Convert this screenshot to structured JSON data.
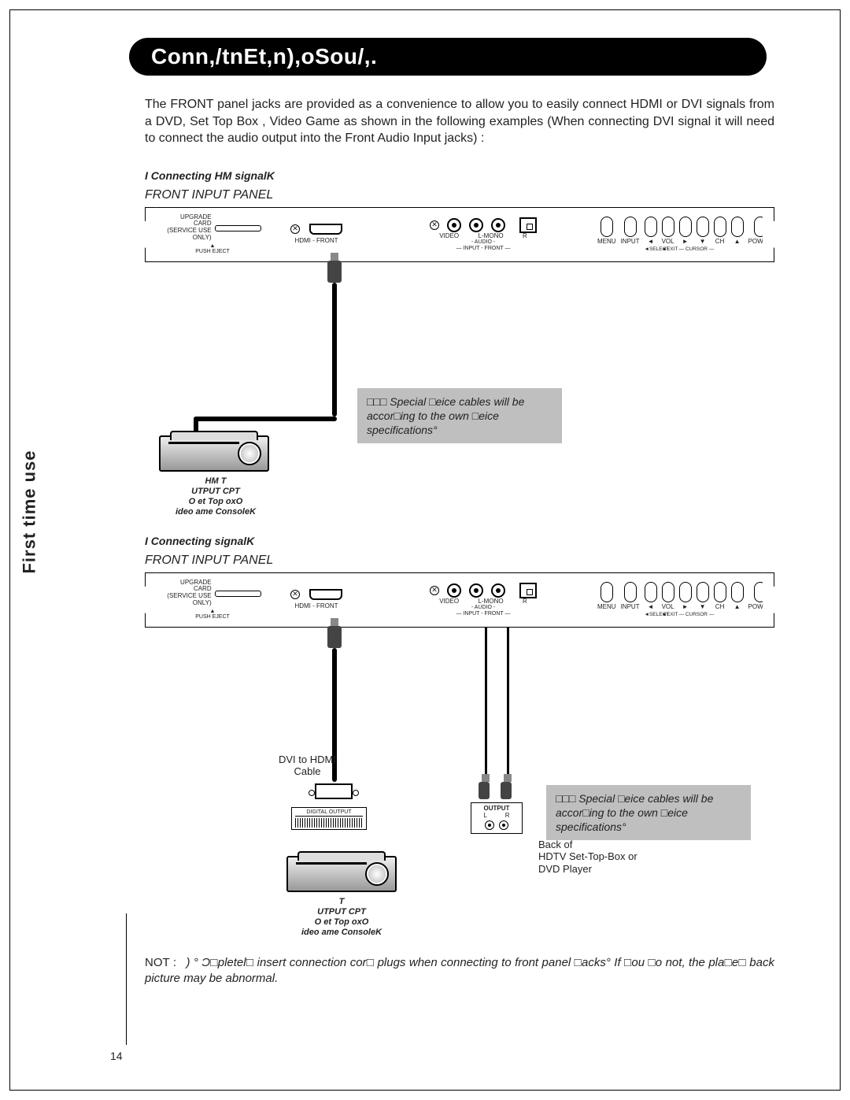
{
  "sidebar_text": "First time use",
  "title": "Conn,/tnEt,n),oSou/,.",
  "intro": "The FRONT panel jacks are provided as a convenience to allow you to easily connect HDMI or DVI signals from a DVD, Set Top Box , Video Game as shown in the following examples (When connecting DVI signal it will need to connect the audio output into the Front Audio Input jacks) :",
  "section1_heading": "I Connecting HM signalK",
  "section2_heading": "I Connecting  signalK",
  "panel_title": "FRONT INPUT PANEL",
  "panel": {
    "upgrade_label_top": "UPGRADE CARD",
    "upgrade_label_sub": "(SERVICE USE ONLY)",
    "upgrade_push": "PUSH EJECT",
    "hdmi_label": "HDMI - FRONT",
    "video_label": "VIDEO",
    "audio_l": "L-MONO",
    "audio_r": "R",
    "audio_group": "- AUDIO -",
    "input_front": "— INPUT - FRONT —",
    "buttons": [
      "MENU",
      "INPUT",
      "◄",
      "VOL",
      "►",
      "▼",
      "CH",
      "▲",
      "POWER"
    ],
    "button_sub": [
      "",
      "◄SELECT",
      "◄EXIT",
      "",
      "",
      "",
      "",
      "",
      ""
    ],
    "cursor_label": "— CURSOR —"
  },
  "device_caption_1": "HM  T\nUTPUT CPT\nO et Top oxO\nideo ame ConsoleK",
  "device_caption_2": "T\nUTPUT CPT\nO et Top oxO\nideo ame ConsoleK",
  "note_text": "□□□ Special □eice cables will be accor□ing to the own □eice specifications°",
  "dvi_label": "DVI to HDMI\nCable",
  "digital_output_label": "DIGITAL OUTPUT",
  "output_label": "OUTPUT",
  "output_l": "L",
  "output_r": "R",
  "back_of_label": "Back of\nHDTV Set-Top-Box or\nDVD Player",
  "footnote_label": "NOT :",
  "footnote_text": ") ° Ɔ□pletel□ insert connection cor□ plugs when connecting to front panel □acks° If □ou □o not, the pla□e□ back picture may be abnormal.",
  "page_number": "14"
}
